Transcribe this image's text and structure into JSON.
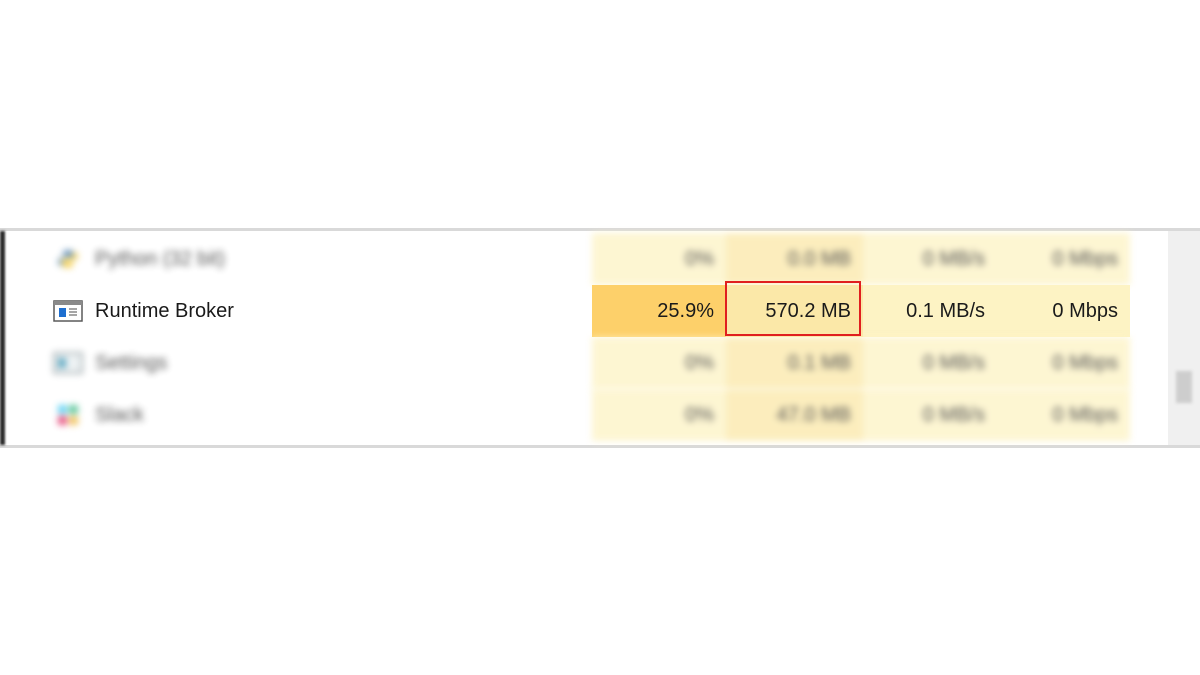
{
  "colors": {
    "cpu_heat_high": "#fdd06a",
    "cell_heat_light": "#fdf3c4",
    "cell_heat_medium": "#fbe8a8",
    "highlight_border": "#e01f1f"
  },
  "processes": [
    {
      "name": "Python (32 bit)",
      "icon": "python-icon",
      "cpu": "0%",
      "memory": "0.0 MB",
      "disk": "0 MB/s",
      "network": "0 Mbps",
      "blurred": true
    },
    {
      "name": "Runtime Broker",
      "icon": "runtime-broker-icon",
      "cpu": "25.9%",
      "memory": "570.2 MB",
      "disk": "0.1 MB/s",
      "network": "0 Mbps",
      "blurred": false
    },
    {
      "name": "Settings",
      "icon": "settings-icon",
      "cpu": "0%",
      "memory": "0.1 MB",
      "disk": "0 MB/s",
      "network": "0 Mbps",
      "blurred": true
    },
    {
      "name": "Slack",
      "icon": "slack-icon",
      "cpu": "0%",
      "memory": "47.0 MB",
      "disk": "0 MB/s",
      "network": "0 Mbps",
      "blurred": true
    }
  ]
}
